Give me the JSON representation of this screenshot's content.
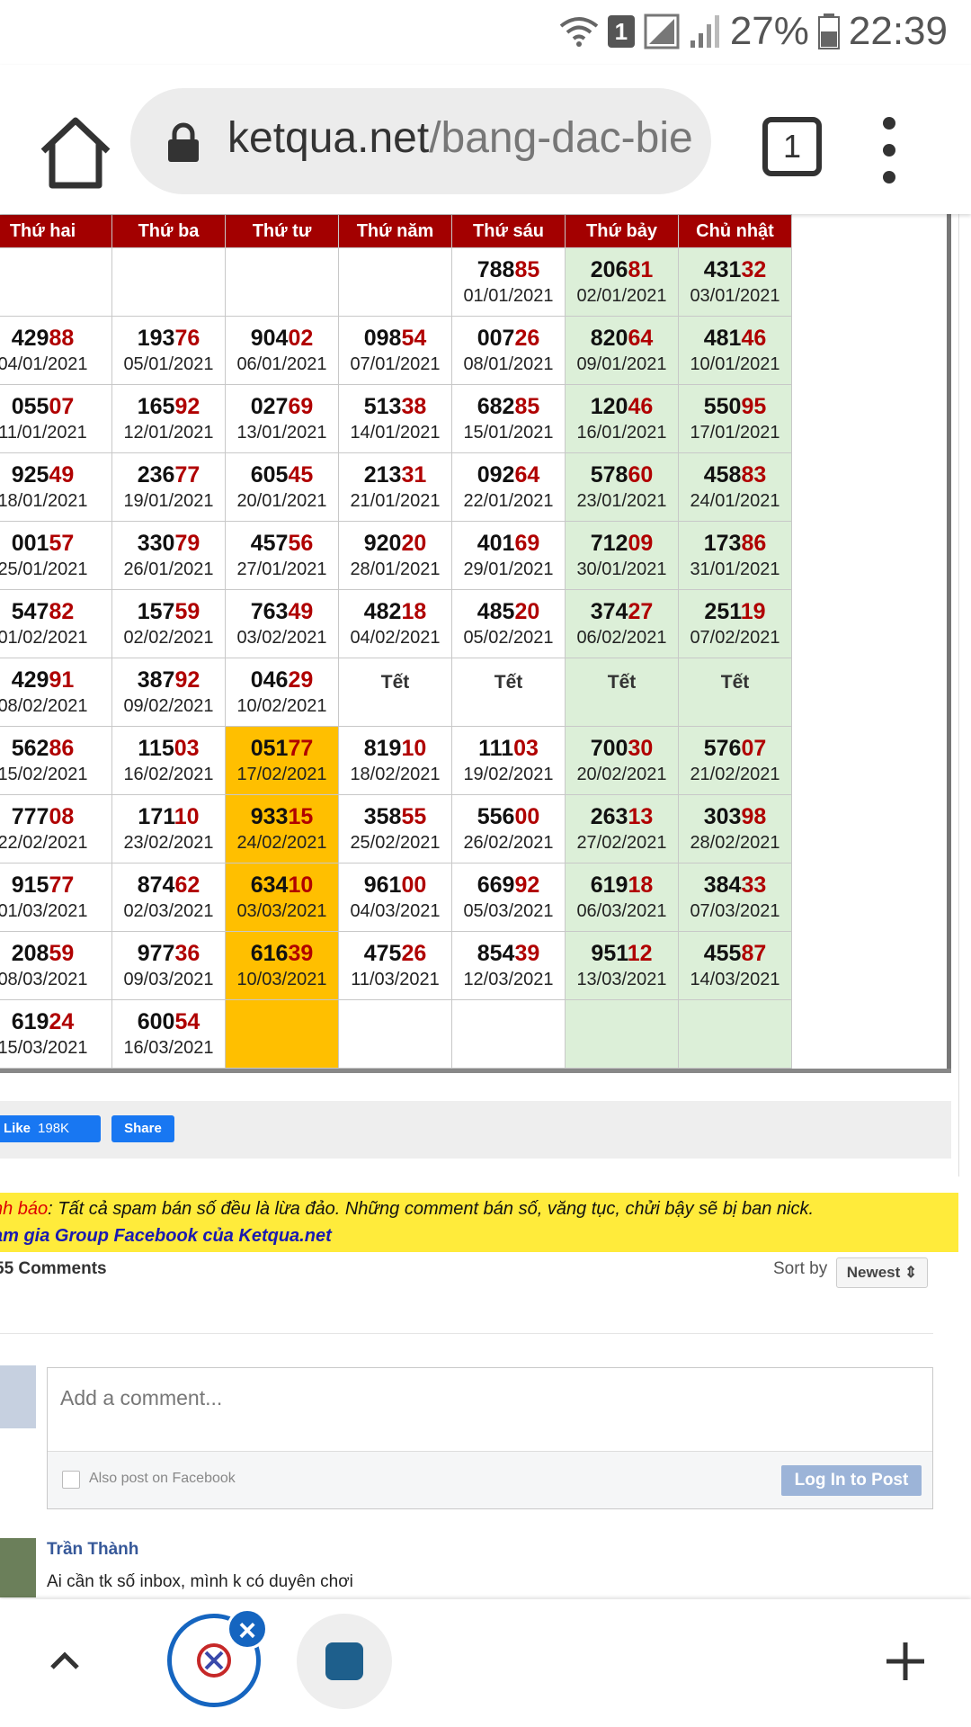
{
  "status_bar": {
    "sim_badge": "1",
    "battery": "27%",
    "time": "22:39"
  },
  "browser": {
    "url_host": "ketqua.net",
    "url_path": "/bang-dac-bie",
    "tab_count": "1"
  },
  "calendar": {
    "headers": [
      "Thứ hai",
      "Thứ ba",
      "Thứ tư",
      "Thứ năm",
      "Thứ sáu",
      "Thứ bảy",
      "Chủ nhật"
    ],
    "weeks": [
      [
        null,
        null,
        null,
        null,
        {
          "head": "788",
          "tail": "85",
          "date": "01/01/2021"
        },
        {
          "head": "206",
          "tail": "81",
          "date": "02/01/2021"
        },
        {
          "head": "431",
          "tail": "32",
          "date": "03/01/2021"
        }
      ],
      [
        {
          "head": "429",
          "tail": "88",
          "date": "04/01/2021"
        },
        {
          "head": "193",
          "tail": "76",
          "date": "05/01/2021"
        },
        {
          "head": "904",
          "tail": "02",
          "date": "06/01/2021"
        },
        {
          "head": "098",
          "tail": "54",
          "date": "07/01/2021"
        },
        {
          "head": "007",
          "tail": "26",
          "date": "08/01/2021"
        },
        {
          "head": "820",
          "tail": "64",
          "date": "09/01/2021"
        },
        {
          "head": "481",
          "tail": "46",
          "date": "10/01/2021"
        }
      ],
      [
        {
          "head": "055",
          "tail": "07",
          "date": "11/01/2021"
        },
        {
          "head": "165",
          "tail": "92",
          "date": "12/01/2021"
        },
        {
          "head": "027",
          "tail": "69",
          "date": "13/01/2021"
        },
        {
          "head": "513",
          "tail": "38",
          "date": "14/01/2021"
        },
        {
          "head": "682",
          "tail": "85",
          "date": "15/01/2021"
        },
        {
          "head": "120",
          "tail": "46",
          "date": "16/01/2021"
        },
        {
          "head": "550",
          "tail": "95",
          "date": "17/01/2021"
        }
      ],
      [
        {
          "head": "925",
          "tail": "49",
          "date": "18/01/2021"
        },
        {
          "head": "236",
          "tail": "77",
          "date": "19/01/2021"
        },
        {
          "head": "605",
          "tail": "45",
          "date": "20/01/2021"
        },
        {
          "head": "213",
          "tail": "31",
          "date": "21/01/2021"
        },
        {
          "head": "092",
          "tail": "64",
          "date": "22/01/2021"
        },
        {
          "head": "578",
          "tail": "60",
          "date": "23/01/2021"
        },
        {
          "head": "458",
          "tail": "83",
          "date": "24/01/2021"
        }
      ],
      [
        {
          "head": "001",
          "tail": "57",
          "date": "25/01/2021"
        },
        {
          "head": "330",
          "tail": "79",
          "date": "26/01/2021"
        },
        {
          "head": "457",
          "tail": "56",
          "date": "27/01/2021"
        },
        {
          "head": "920",
          "tail": "20",
          "date": "28/01/2021"
        },
        {
          "head": "401",
          "tail": "69",
          "date": "29/01/2021"
        },
        {
          "head": "712",
          "tail": "09",
          "date": "30/01/2021"
        },
        {
          "head": "173",
          "tail": "86",
          "date": "31/01/2021"
        }
      ],
      [
        {
          "head": "547",
          "tail": "82",
          "date": "01/02/2021"
        },
        {
          "head": "157",
          "tail": "59",
          "date": "02/02/2021"
        },
        {
          "head": "763",
          "tail": "49",
          "date": "03/02/2021"
        },
        {
          "head": "482",
          "tail": "18",
          "date": "04/02/2021"
        },
        {
          "head": "485",
          "tail": "20",
          "date": "05/02/2021"
        },
        {
          "head": "374",
          "tail": "27",
          "date": "06/02/2021"
        },
        {
          "head": "251",
          "tail": "19",
          "date": "07/02/2021"
        }
      ],
      [
        {
          "head": "429",
          "tail": "91",
          "date": "08/02/2021"
        },
        {
          "head": "387",
          "tail": "92",
          "date": "09/02/2021"
        },
        {
          "head": "046",
          "tail": "29",
          "date": "10/02/2021"
        },
        {
          "tet": "Tết"
        },
        {
          "tet": "Tết"
        },
        {
          "tet": "Tết"
        },
        {
          "tet": "Tết"
        }
      ],
      [
        {
          "head": "562",
          "tail": "86",
          "date": "15/02/2021"
        },
        {
          "head": "115",
          "tail": "03",
          "date": "16/02/2021"
        },
        {
          "head": "051",
          "tail": "77",
          "date": "17/02/2021"
        },
        {
          "head": "819",
          "tail": "10",
          "date": "18/02/2021"
        },
        {
          "head": "111",
          "tail": "03",
          "date": "19/02/2021"
        },
        {
          "head": "700",
          "tail": "30",
          "date": "20/02/2021"
        },
        {
          "head": "576",
          "tail": "07",
          "date": "21/02/2021"
        }
      ],
      [
        {
          "head": "777",
          "tail": "08",
          "date": "22/02/2021"
        },
        {
          "head": "171",
          "tail": "10",
          "date": "23/02/2021"
        },
        {
          "head": "933",
          "tail": "15",
          "date": "24/02/2021"
        },
        {
          "head": "358",
          "tail": "55",
          "date": "25/02/2021"
        },
        {
          "head": "556",
          "tail": "00",
          "date": "26/02/2021"
        },
        {
          "head": "263",
          "tail": "13",
          "date": "27/02/2021"
        },
        {
          "head": "303",
          "tail": "98",
          "date": "28/02/2021"
        }
      ],
      [
        {
          "head": "915",
          "tail": "77",
          "date": "01/03/2021"
        },
        {
          "head": "874",
          "tail": "62",
          "date": "02/03/2021"
        },
        {
          "head": "634",
          "tail": "10",
          "date": "03/03/2021"
        },
        {
          "head": "961",
          "tail": "00",
          "date": "04/03/2021"
        },
        {
          "head": "669",
          "tail": "92",
          "date": "05/03/2021"
        },
        {
          "head": "619",
          "tail": "18",
          "date": "06/03/2021"
        },
        {
          "head": "384",
          "tail": "33",
          "date": "07/03/2021"
        }
      ],
      [
        {
          "head": "208",
          "tail": "59",
          "date": "08/03/2021"
        },
        {
          "head": "977",
          "tail": "36",
          "date": "09/03/2021"
        },
        {
          "head": "616",
          "tail": "39",
          "date": "10/03/2021"
        },
        {
          "head": "475",
          "tail": "26",
          "date": "11/03/2021"
        },
        {
          "head": "854",
          "tail": "39",
          "date": "12/03/2021"
        },
        {
          "head": "951",
          "tail": "12",
          "date": "13/03/2021"
        },
        {
          "head": "455",
          "tail": "87",
          "date": "14/03/2021"
        }
      ],
      [
        {
          "head": "619",
          "tail": "24",
          "date": "15/03/2021"
        },
        {
          "head": "600",
          "tail": "54",
          "date": "16/03/2021"
        },
        null,
        null,
        null,
        null,
        null
      ]
    ],
    "colors": {
      "header_bg": "#a30000",
      "tail_red": "#b00000",
      "weekend_bg": "#dcefd8",
      "highlight_bg": "#ffbf00"
    }
  },
  "social": {
    "like_label": "Like",
    "like_count": "198K",
    "share_label": "Share"
  },
  "warning": {
    "label": "nh báo",
    "text": ": Tất cả spam bán số đều là lừa đảo. Những comment bán số, văng tục, chửi bậy sẽ bị ban nick.",
    "link": "am gia Group Facebook của Ketqua.net"
  },
  "comments": {
    "count_label": "55 Comments",
    "sort_label": "Sort by",
    "sort_value": "Newest ⇕",
    "input_placeholder": "Add a comment...",
    "also_post_label": "Also post on Facebook",
    "post_button": "Log In to Post",
    "first_comment": {
      "author": "Trần Thành",
      "text": "Ai cần tk số inbox, mình k có duyên chơi"
    }
  }
}
